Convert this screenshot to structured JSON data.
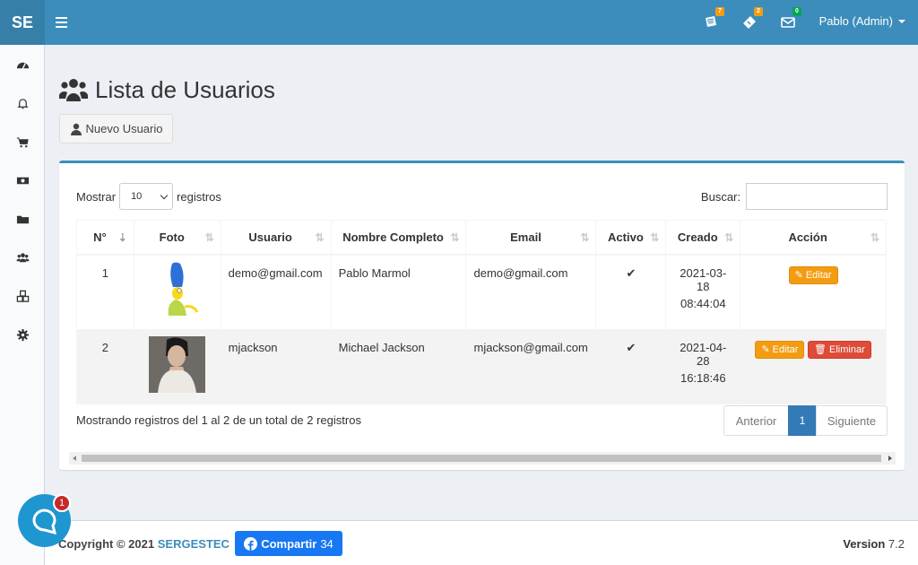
{
  "header": {
    "logo": "SE",
    "user_label": "Pablo (Admin)",
    "badges": {
      "notes": "7",
      "tickets": "2",
      "mail": "0"
    },
    "colors": {
      "bar": "#3c8dbc",
      "warning": "#f39c12",
      "success": "#00a65a"
    }
  },
  "sidebar": {
    "items": [
      {
        "icon": "dashboard-icon"
      },
      {
        "icon": "bell-icon"
      },
      {
        "icon": "cart-icon"
      },
      {
        "icon": "money-icon"
      },
      {
        "icon": "folder-icon"
      },
      {
        "icon": "users-icon"
      },
      {
        "icon": "cubes-icon"
      },
      {
        "icon": "gear-icon"
      }
    ]
  },
  "page": {
    "title": "Lista de Usuarios",
    "new_button": "Nuevo Usuario"
  },
  "table_controls": {
    "show_label": "Mostrar",
    "show_value": "10",
    "records_label": "registros",
    "search_label": "Buscar:",
    "search_value": ""
  },
  "table": {
    "columns": [
      "N°",
      "Foto",
      "Usuario",
      "Nombre Completo",
      "Email",
      "Activo",
      "Creado",
      "Acción"
    ],
    "rows": [
      {
        "n": "1",
        "usuario": "demo@gmail.com",
        "nombre": "Pablo Marmol",
        "email": "demo@gmail.com",
        "activo": "✔",
        "creado_date": "2021-03-18",
        "creado_time": "08:44:04",
        "actions": [
          "Editar"
        ]
      },
      {
        "n": "2",
        "usuario": "mjackson",
        "nombre": "Michael Jackson",
        "email": "mjackson@gmail.com",
        "activo": "✔",
        "creado_date": "2021-04-28",
        "creado_time": "16:18:46",
        "actions": [
          "Editar",
          "Eliminar"
        ]
      }
    ]
  },
  "table_footer": {
    "info": "Mostrando registros del 1 al 2 de un total de 2 registros",
    "prev": "Anterior",
    "current": "1",
    "next": "Siguiente"
  },
  "footer": {
    "copyright_prefix": "Copyright © 2021",
    "brand": "SERGESTEC",
    "share_label": "Compartir",
    "share_count": "34",
    "version_label": "Version",
    "version_value": "7.2"
  },
  "chat": {
    "unread": "1"
  }
}
